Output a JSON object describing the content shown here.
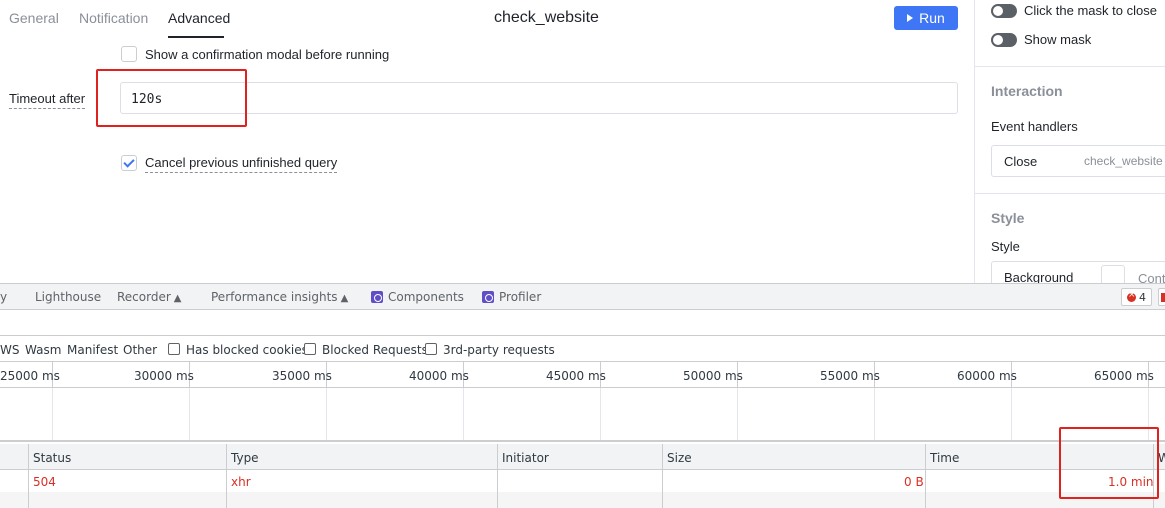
{
  "app": {
    "tabs": [
      "General",
      "Notification",
      "Advanced"
    ],
    "active_tab": "Advanced",
    "query_name": "check_website",
    "run_label": "Run",
    "confirm_modal_label": "Show a confirmation modal before running",
    "timeout_label": "Timeout after",
    "timeout_value": "120s",
    "cancel_previous_label": "Cancel previous unfinished query"
  },
  "right_panel": {
    "click_mask_close": "Click the mask to close",
    "show_mask": "Show mask",
    "interaction_heading": "Interaction",
    "event_handlers_label": "Event handlers",
    "event_handler_event": "Close",
    "event_handler_target": "check_website",
    "style_heading": "Style",
    "style_label": "Style",
    "background_label": "Background",
    "background_value_partial": "Cont"
  },
  "devtools": {
    "tabs": [
      "Lighthouse",
      "Recorder",
      "Performance insights",
      "Components",
      "Profiler"
    ],
    "left_partial_tab": "y",
    "error_count": "4",
    "filter_types": [
      "WS",
      "Wasm",
      "Manifest",
      "Other"
    ],
    "filter_checks": [
      "Has blocked cookies",
      "Blocked Requests",
      "3rd-party requests"
    ],
    "timeline_ticks": [
      "25000 ms",
      "30000 ms",
      "35000 ms",
      "40000 ms",
      "45000 ms",
      "50000 ms",
      "55000 ms",
      "60000 ms",
      "65000 ms"
    ],
    "columns": [
      "Status",
      "Type",
      "Initiator",
      "Size",
      "Time",
      "W"
    ],
    "row": {
      "status": "504",
      "type": "xhr",
      "initiator": "",
      "size": "0 B",
      "time": "1.0 min"
    }
  },
  "colors": {
    "accent": "#3f76f5",
    "highlight_box": "#e0221f",
    "error_text": "#d93025"
  }
}
